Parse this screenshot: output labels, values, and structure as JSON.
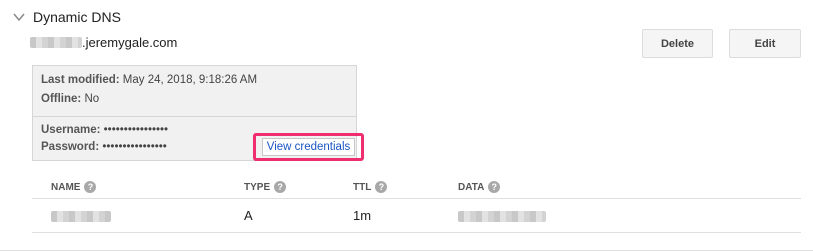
{
  "section": {
    "title": "Dynamic DNS"
  },
  "record": {
    "domain_suffix": ".jeremygale.com"
  },
  "actions": {
    "delete_label": "Delete",
    "edit_label": "Edit"
  },
  "info": {
    "last_modified_label": "Last modified:",
    "last_modified_value": "May 24, 2018, 9:18:26 AM",
    "offline_label": "Offline:",
    "offline_value": "No",
    "username_label": "Username:",
    "username_value": "••••••••••••••••",
    "password_label": "Password:",
    "password_value": "••••••••••••••••",
    "view_credentials_label": "View credentials",
    "highlight_color": "#ee2e6f"
  },
  "table": {
    "headers": {
      "name": "NAME",
      "type": "TYPE",
      "ttl": "TTL",
      "data": "DATA"
    },
    "rows": [
      {
        "type": "A",
        "ttl": "1m"
      }
    ]
  },
  "icons": {
    "collapse": "chevron-down-icon",
    "help": "help-circle-icon"
  },
  "help_glyph": "?"
}
